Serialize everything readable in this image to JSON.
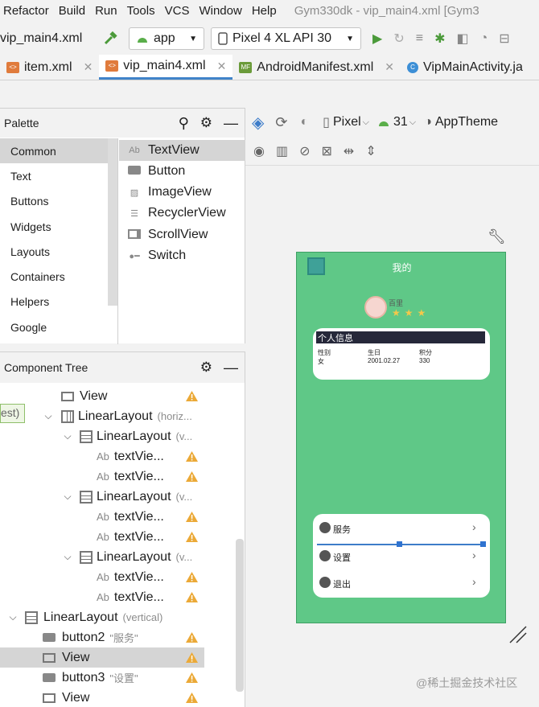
{
  "menu": [
    "Refactor",
    "Build",
    "Run",
    "Tools",
    "VCS",
    "Window",
    "Help"
  ],
  "window_title": "Gym330dk - vip_main4.xml [Gym3",
  "toolbar": {
    "file": "vip_main4.xml",
    "module": "app",
    "device": "Pixel 4 XL API 30"
  },
  "tabs": [
    {
      "label": "item.xml",
      "icon": "xml-file-icon"
    },
    {
      "label": "vip_main4.xml",
      "icon": "xml-file-icon",
      "active": true
    },
    {
      "label": "AndroidManifest.xml",
      "icon": "manifest-file-icon"
    },
    {
      "label": "VipMainActivity.ja",
      "icon": "class-file-icon"
    }
  ],
  "palette": {
    "title": "Palette",
    "categories": [
      "Common",
      "Text",
      "Buttons",
      "Widgets",
      "Layouts",
      "Containers",
      "Helpers",
      "Google"
    ],
    "selected_category": "Common",
    "items": [
      {
        "label": "TextView",
        "icon": "textview-icon"
      },
      {
        "label": "Button",
        "icon": "button-icon"
      },
      {
        "label": "ImageView",
        "icon": "image-icon"
      },
      {
        "label": "RecyclerView",
        "icon": "list-icon"
      },
      {
        "label": "ScrollView",
        "icon": "scrollview-icon"
      },
      {
        "label": "Switch",
        "icon": "switch-icon"
      }
    ]
  },
  "design_toolbar": {
    "device": "Pixel",
    "api": "31",
    "theme": "AppTheme"
  },
  "component_tree": {
    "title": "Component Tree",
    "side_hint": "est)",
    "rows": [
      {
        "label": "View",
        "hint": "",
        "icon": "view-icon",
        "warn": true
      },
      {
        "label": "LinearLayout",
        "hint": "(horiz...",
        "icon": "horizontal-layout-icon",
        "warn": false,
        "expanded": true
      },
      {
        "label": "LinearLayout",
        "hint": "(v...",
        "icon": "vertical-layout-icon",
        "warn": false,
        "expanded": true
      },
      {
        "label": "textVie...",
        "hint": "",
        "icon": "textview-icon",
        "warn": true
      },
      {
        "label": "textVie...",
        "hint": "",
        "icon": "textview-icon",
        "warn": true
      },
      {
        "label": "LinearLayout",
        "hint": "(v...",
        "icon": "vertical-layout-icon",
        "warn": false,
        "expanded": true
      },
      {
        "label": "textVie...",
        "hint": "",
        "icon": "textview-icon",
        "warn": true
      },
      {
        "label": "textVie...",
        "hint": "",
        "icon": "textview-icon",
        "warn": true
      },
      {
        "label": "LinearLayout",
        "hint": "(v...",
        "icon": "vertical-layout-icon",
        "warn": false,
        "expanded": true
      },
      {
        "label": "textVie...",
        "hint": "",
        "icon": "textview-icon",
        "warn": true
      },
      {
        "label": "textVie...",
        "hint": "",
        "icon": "textview-icon",
        "warn": true
      },
      {
        "label": "LinearLayout",
        "hint": "(vertical)",
        "icon": "vertical-layout-icon",
        "warn": false,
        "expanded": true
      },
      {
        "label": "button2",
        "hint": "\"服务\"",
        "icon": "button-icon",
        "warn": true
      },
      {
        "label": "View",
        "hint": "",
        "icon": "view-icon",
        "warn": true,
        "selected": true
      },
      {
        "label": "button3",
        "hint": "\"设置\"",
        "icon": "button-icon",
        "warn": true
      },
      {
        "label": "View",
        "hint": "",
        "icon": "view-icon",
        "warn": true
      }
    ]
  },
  "preview": {
    "title": "我的",
    "username": "百里",
    "info_header": "个人信息",
    "info_cols": [
      {
        "k": "性别",
        "v": "女"
      },
      {
        "k": "生日",
        "v": "2001.02.27"
      },
      {
        "k": "积分",
        "v": "330"
      }
    ],
    "menu_items": [
      "服务",
      "设置",
      "退出"
    ],
    "bg_color": "#5fc887"
  },
  "watermark": "@稀土掘金技术社区"
}
